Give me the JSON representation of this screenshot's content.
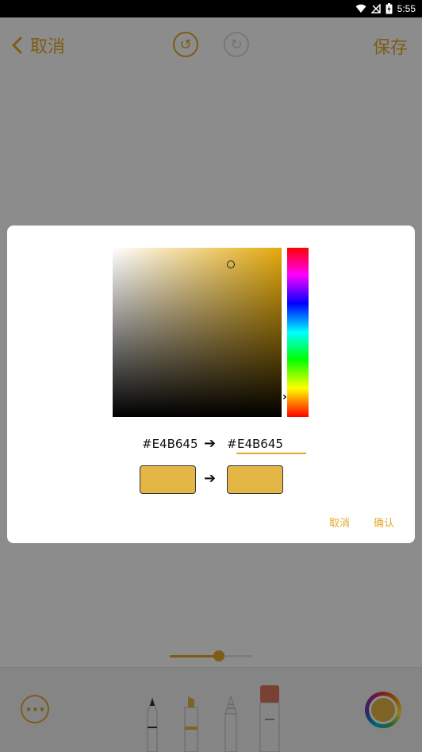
{
  "status_bar": {
    "time": "5:55"
  },
  "header": {
    "cancel_label": "取消",
    "save_label": "保存",
    "back_glyph": "‹",
    "undo_glyph": "↺",
    "redo_glyph": "↻"
  },
  "brush_size": {
    "value": 0.6
  },
  "toolbar": {
    "tools": [
      "pencil",
      "marker",
      "crayon",
      "eraser"
    ],
    "selected_color": "#E4B645"
  },
  "color_picker": {
    "old_hex": "#E4B645",
    "hash_prefix": "#",
    "new_hex_value": "E4B645",
    "old_color": "#E4B645",
    "new_color": "#E4B645",
    "cancel_label": "取消",
    "confirm_label": "确认"
  },
  "colors": {
    "accent": "#E6A82A"
  }
}
